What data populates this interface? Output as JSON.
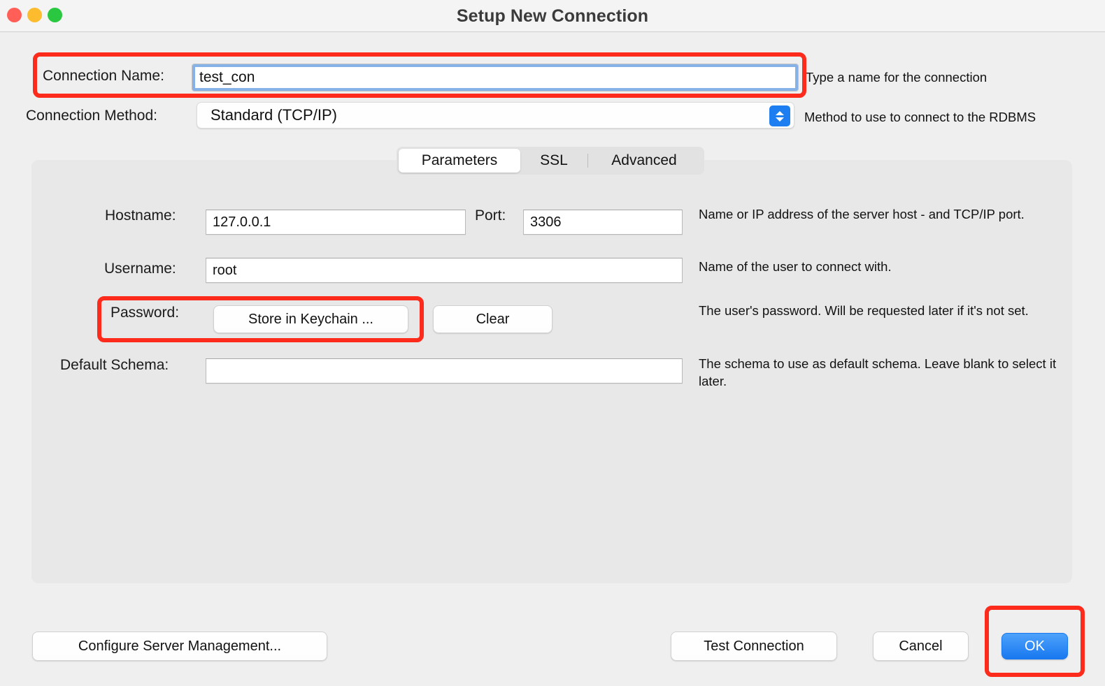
{
  "window": {
    "title": "Setup New Connection",
    "traffic_lights": [
      {
        "name": "close",
        "color": "#ff5f57"
      },
      {
        "name": "minimize",
        "color": "#fcbc2e"
      },
      {
        "name": "zoom",
        "color": "#29c840"
      }
    ]
  },
  "form": {
    "connection_name": {
      "label": "Connection Name:",
      "value": "test_con",
      "help": "Type a name for the connection"
    },
    "connection_method": {
      "label": "Connection Method:",
      "value": "Standard (TCP/IP)",
      "help": "Method to use to connect to the RDBMS"
    }
  },
  "tabs": [
    {
      "label": "Parameters",
      "active": true
    },
    {
      "label": "SSL",
      "active": false
    },
    {
      "label": "Advanced",
      "active": false
    }
  ],
  "parameters": {
    "hostname": {
      "label": "Hostname:",
      "value": "127.0.0.1"
    },
    "port": {
      "label": "Port:",
      "value": "3306"
    },
    "hostname_help": "Name or IP address of the server host - and TCP/IP port.",
    "username": {
      "label": "Username:",
      "value": "root"
    },
    "username_help": "Name of the user to connect with.",
    "password": {
      "label": "Password:",
      "store_button": "Store in Keychain ...",
      "clear_button": "Clear"
    },
    "password_help": "The user's password. Will be requested later if it's not set.",
    "default_schema": {
      "label": "Default Schema:",
      "value": "",
      "placeholder": ""
    },
    "default_schema_help": "The schema to use as default schema. Leave blank to select it later."
  },
  "footer": {
    "configure": "Configure Server Management...",
    "test_connection": "Test Connection",
    "cancel": "Cancel",
    "ok": "OK"
  },
  "annotations": {
    "color": "#fc2b1c",
    "targets": [
      "connection-name-row",
      "password-row",
      "ok-button"
    ]
  },
  "colors": {
    "window_background": "#efefef",
    "panel_background": "#e8e8e8",
    "titlebar_background": "#f4f4f4",
    "accent_blue": "#1d7ef2",
    "focus_ring": "#86b2e8",
    "annotation_red": "#fc2b1c"
  }
}
